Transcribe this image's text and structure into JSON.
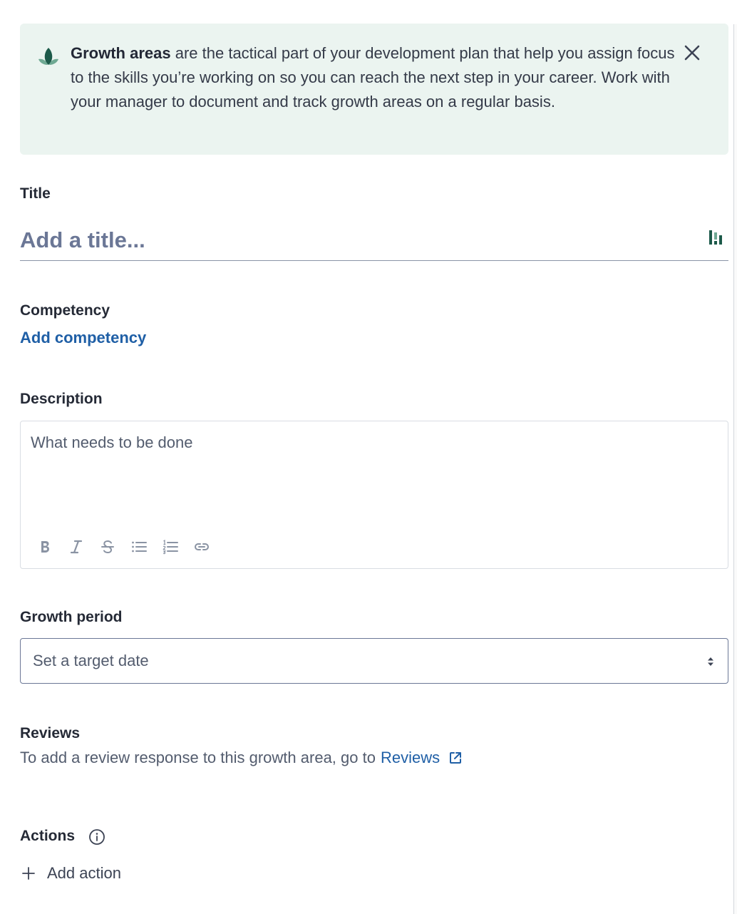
{
  "banner": {
    "icon": "growth-leaf-icon",
    "bold_text": "Growth areas",
    "body_text": " are the tactical part of your development plan that help you assign focus to the skills you’re working on so you can reach the next step in your career. Work with your manager to document and track growth areas on a regular basis.",
    "close_icon": "close-icon"
  },
  "title": {
    "label": "Title",
    "placeholder": "Add a title...",
    "icon": "formatting-icon"
  },
  "competency": {
    "label": "Competency",
    "link": "Add competency"
  },
  "description": {
    "label": "Description",
    "placeholder": "What needs to be done",
    "toolbar": [
      "bold-icon",
      "italic-icon",
      "strikethrough-icon",
      "bulleted-list-icon",
      "numbered-list-icon",
      "link-icon"
    ]
  },
  "growth_period": {
    "label": "Growth period",
    "placeholder": "Set a target date"
  },
  "reviews": {
    "label": "Reviews",
    "text": "To add a review response to this growth area, go to",
    "link": "Reviews"
  },
  "actions": {
    "label": "Actions",
    "add_label": "Add action"
  },
  "colors": {
    "banner_bg": "#ebf4f0",
    "link": "#1f5fa6",
    "leaf_dark": "#1d5a4a",
    "leaf_light": "#6fa993"
  }
}
